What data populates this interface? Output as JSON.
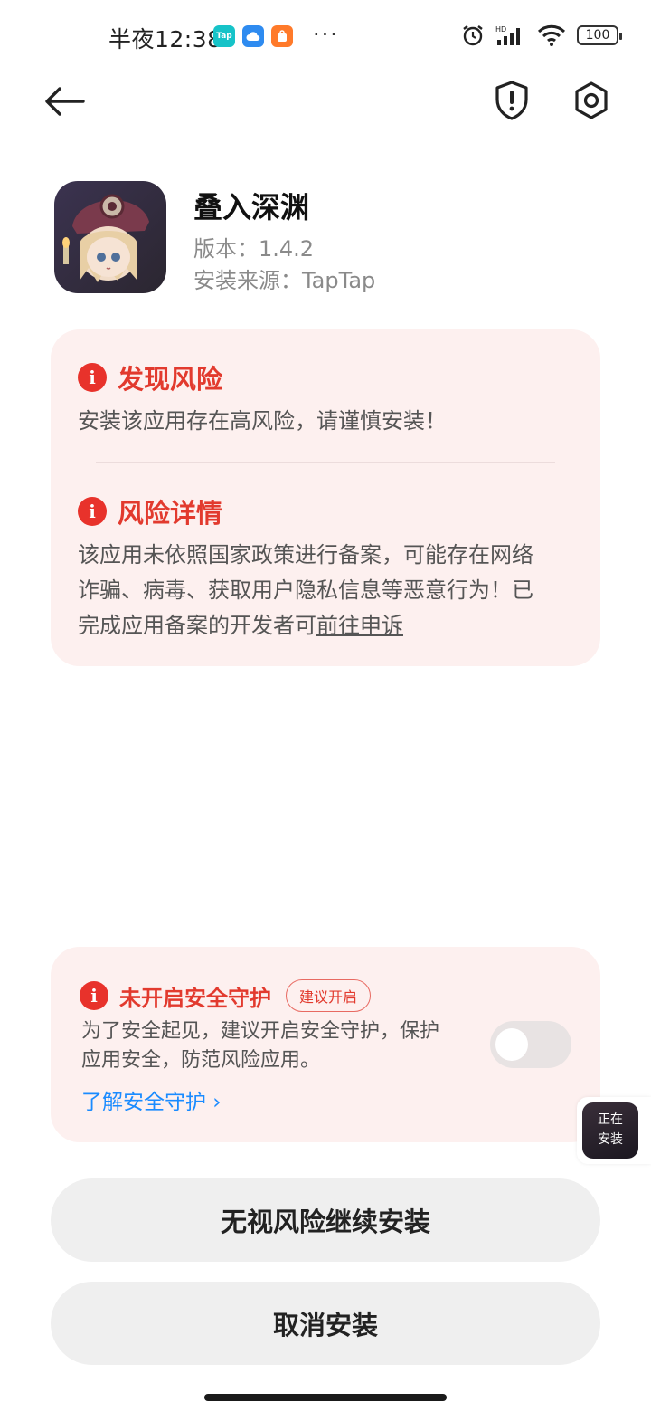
{
  "status_bar": {
    "time": "半夜12:38",
    "notifications": [
      "tap-icon",
      "cloud-icon",
      "mall-icon"
    ],
    "more": "···",
    "battery": "100"
  },
  "header": {
    "back_icon": "arrow-left-icon",
    "shield_icon": "shield-alert-icon",
    "settings_icon": "gear-icon"
  },
  "app": {
    "name": "叠入深渊",
    "version": "版本：1.4.2",
    "source": "安装来源：TapTap"
  },
  "risk": {
    "found_title": "发现风险",
    "found_text": "安装该应用存在高风险，请谨慎安装！",
    "detail_title": "风险详情",
    "detail_line1": "该应用未依照国家政策进行备案，可能存在网络",
    "detail_line2": "诈骗、病毒、获取用户隐私信息等恶意行为！已",
    "detail_line3_prefix": "完成应用备案的开发者可",
    "appeal_link": "前往申诉"
  },
  "protection": {
    "title": "未开启安全守护",
    "badge": "建议开启",
    "text_line1": "为了安全起见，建议开启安全守护，保护",
    "text_line2": "应用安全，防范风险应用。",
    "learn_more": "了解安全守护 ›",
    "enabled": false
  },
  "install_bubble": {
    "line1": "正在",
    "line2": "安装"
  },
  "buttons": {
    "continue": "无视风险继续安装",
    "cancel": "取消安装"
  },
  "colors": {
    "danger": "#e23a2e",
    "card_bg": "#fdf0ef",
    "link": "#1a8bff",
    "button_bg": "#efefef"
  }
}
